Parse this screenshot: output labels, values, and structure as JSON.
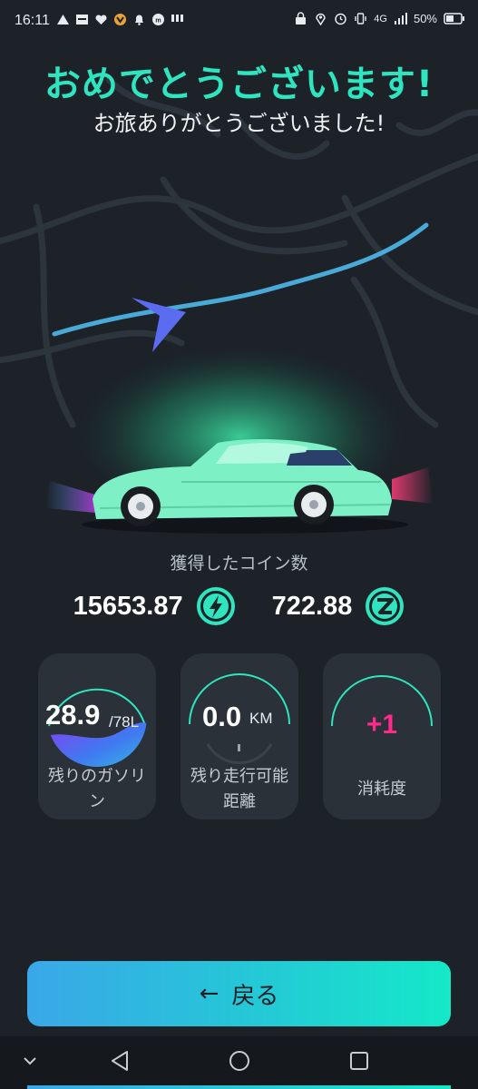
{
  "status_bar": {
    "time": "16:11",
    "battery_percent": "50%",
    "network": "4G",
    "nfc": "NFC",
    "left_icons": [
      "triangle-icon",
      "bybit-icon",
      "heart-icon",
      "badge-icon",
      "bell-icon",
      "mb-icon",
      "grid-icon"
    ],
    "right_icons": [
      "lock-nfc-icon",
      "location-icon",
      "alarm-icon",
      "vibrate-icon",
      "signal-icon",
      "battery-icon"
    ]
  },
  "header": {
    "title": "おめでとうございます!",
    "subtitle": "お旅ありがとうございました!"
  },
  "coins": {
    "caption": "獲得したコイン数",
    "energy_value": "15653.87",
    "energy_icon": "lightning-icon",
    "z_value": "722.88",
    "z_icon": "z-coin-icon"
  },
  "cards": {
    "fuel": {
      "value": "28.9",
      "unit": "/78L",
      "label_line1": "残りのガソリ",
      "label_line2": "ン",
      "fill_fraction": 0.37
    },
    "range": {
      "value": "0.0",
      "unit": "KM",
      "label_line1": "残り走行可能",
      "label_line2": "距離"
    },
    "consumption": {
      "value": "+1",
      "label": "消耗度"
    }
  },
  "back_button": {
    "label": "戻る",
    "icon": "arrow-left-icon"
  },
  "nav": {
    "icons": [
      "chevron-down-icon",
      "back-triangle-icon",
      "home-circle-icon",
      "recents-square-icon"
    ]
  },
  "colors": {
    "accent": "#2fe5bf",
    "background": "#1c2228",
    "card": "#2a3139",
    "pink": "#ff2a8a",
    "car": "#7ef0c6"
  }
}
